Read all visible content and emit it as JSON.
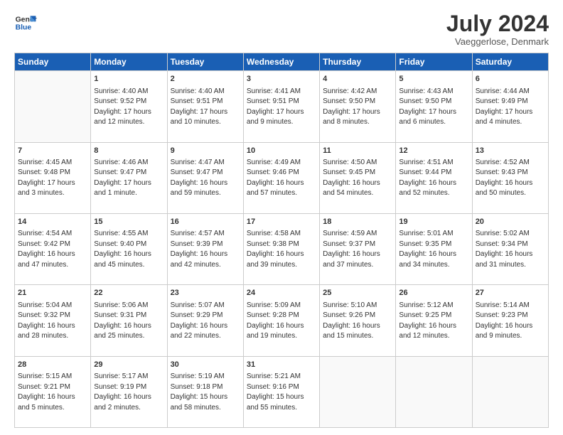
{
  "header": {
    "logo_general": "General",
    "logo_blue": "Blue",
    "title": "July 2024",
    "subtitle": "Vaeggerlose, Denmark"
  },
  "columns": [
    "Sunday",
    "Monday",
    "Tuesday",
    "Wednesday",
    "Thursday",
    "Friday",
    "Saturday"
  ],
  "weeks": [
    [
      {
        "day": "",
        "info": ""
      },
      {
        "day": "1",
        "info": "Sunrise: 4:40 AM\nSunset: 9:52 PM\nDaylight: 17 hours\nand 12 minutes."
      },
      {
        "day": "2",
        "info": "Sunrise: 4:40 AM\nSunset: 9:51 PM\nDaylight: 17 hours\nand 10 minutes."
      },
      {
        "day": "3",
        "info": "Sunrise: 4:41 AM\nSunset: 9:51 PM\nDaylight: 17 hours\nand 9 minutes."
      },
      {
        "day": "4",
        "info": "Sunrise: 4:42 AM\nSunset: 9:50 PM\nDaylight: 17 hours\nand 8 minutes."
      },
      {
        "day": "5",
        "info": "Sunrise: 4:43 AM\nSunset: 9:50 PM\nDaylight: 17 hours\nand 6 minutes."
      },
      {
        "day": "6",
        "info": "Sunrise: 4:44 AM\nSunset: 9:49 PM\nDaylight: 17 hours\nand 4 minutes."
      }
    ],
    [
      {
        "day": "7",
        "info": "Sunrise: 4:45 AM\nSunset: 9:48 PM\nDaylight: 17 hours\nand 3 minutes."
      },
      {
        "day": "8",
        "info": "Sunrise: 4:46 AM\nSunset: 9:47 PM\nDaylight: 17 hours\nand 1 minute."
      },
      {
        "day": "9",
        "info": "Sunrise: 4:47 AM\nSunset: 9:47 PM\nDaylight: 16 hours\nand 59 minutes."
      },
      {
        "day": "10",
        "info": "Sunrise: 4:49 AM\nSunset: 9:46 PM\nDaylight: 16 hours\nand 57 minutes."
      },
      {
        "day": "11",
        "info": "Sunrise: 4:50 AM\nSunset: 9:45 PM\nDaylight: 16 hours\nand 54 minutes."
      },
      {
        "day": "12",
        "info": "Sunrise: 4:51 AM\nSunset: 9:44 PM\nDaylight: 16 hours\nand 52 minutes."
      },
      {
        "day": "13",
        "info": "Sunrise: 4:52 AM\nSunset: 9:43 PM\nDaylight: 16 hours\nand 50 minutes."
      }
    ],
    [
      {
        "day": "14",
        "info": "Sunrise: 4:54 AM\nSunset: 9:42 PM\nDaylight: 16 hours\nand 47 minutes."
      },
      {
        "day": "15",
        "info": "Sunrise: 4:55 AM\nSunset: 9:40 PM\nDaylight: 16 hours\nand 45 minutes."
      },
      {
        "day": "16",
        "info": "Sunrise: 4:57 AM\nSunset: 9:39 PM\nDaylight: 16 hours\nand 42 minutes."
      },
      {
        "day": "17",
        "info": "Sunrise: 4:58 AM\nSunset: 9:38 PM\nDaylight: 16 hours\nand 39 minutes."
      },
      {
        "day": "18",
        "info": "Sunrise: 4:59 AM\nSunset: 9:37 PM\nDaylight: 16 hours\nand 37 minutes."
      },
      {
        "day": "19",
        "info": "Sunrise: 5:01 AM\nSunset: 9:35 PM\nDaylight: 16 hours\nand 34 minutes."
      },
      {
        "day": "20",
        "info": "Sunrise: 5:02 AM\nSunset: 9:34 PM\nDaylight: 16 hours\nand 31 minutes."
      }
    ],
    [
      {
        "day": "21",
        "info": "Sunrise: 5:04 AM\nSunset: 9:32 PM\nDaylight: 16 hours\nand 28 minutes."
      },
      {
        "day": "22",
        "info": "Sunrise: 5:06 AM\nSunset: 9:31 PM\nDaylight: 16 hours\nand 25 minutes."
      },
      {
        "day": "23",
        "info": "Sunrise: 5:07 AM\nSunset: 9:29 PM\nDaylight: 16 hours\nand 22 minutes."
      },
      {
        "day": "24",
        "info": "Sunrise: 5:09 AM\nSunset: 9:28 PM\nDaylight: 16 hours\nand 19 minutes."
      },
      {
        "day": "25",
        "info": "Sunrise: 5:10 AM\nSunset: 9:26 PM\nDaylight: 16 hours\nand 15 minutes."
      },
      {
        "day": "26",
        "info": "Sunrise: 5:12 AM\nSunset: 9:25 PM\nDaylight: 16 hours\nand 12 minutes."
      },
      {
        "day": "27",
        "info": "Sunrise: 5:14 AM\nSunset: 9:23 PM\nDaylight: 16 hours\nand 9 minutes."
      }
    ],
    [
      {
        "day": "28",
        "info": "Sunrise: 5:15 AM\nSunset: 9:21 PM\nDaylight: 16 hours\nand 5 minutes."
      },
      {
        "day": "29",
        "info": "Sunrise: 5:17 AM\nSunset: 9:19 PM\nDaylight: 16 hours\nand 2 minutes."
      },
      {
        "day": "30",
        "info": "Sunrise: 5:19 AM\nSunset: 9:18 PM\nDaylight: 15 hours\nand 58 minutes."
      },
      {
        "day": "31",
        "info": "Sunrise: 5:21 AM\nSunset: 9:16 PM\nDaylight: 15 hours\nand 55 minutes."
      },
      {
        "day": "",
        "info": ""
      },
      {
        "day": "",
        "info": ""
      },
      {
        "day": "",
        "info": ""
      }
    ]
  ]
}
